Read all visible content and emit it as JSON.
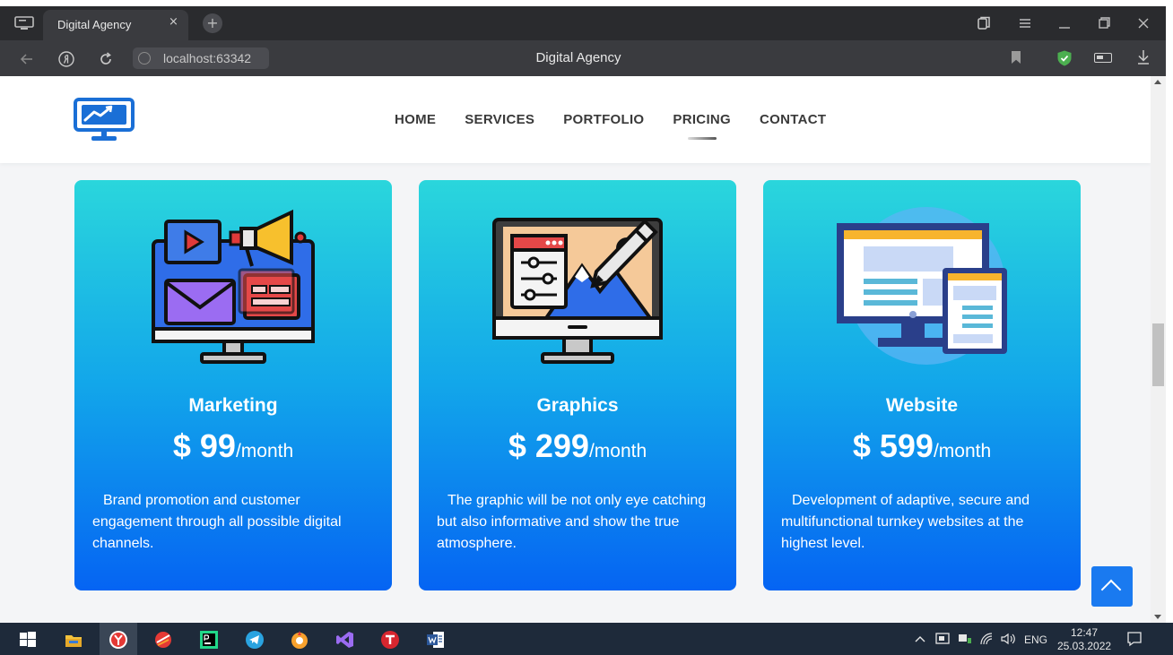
{
  "browser": {
    "tab_title": "Digital Agency",
    "tab_close": "×",
    "new_tab": "+",
    "url": "localhost:63342",
    "page_title": "Digital Agency"
  },
  "site": {
    "nav": [
      {
        "label": "HOME",
        "active": false
      },
      {
        "label": "SERVICES",
        "active": false
      },
      {
        "label": "PORTFOLIO",
        "active": false
      },
      {
        "label": "PRICING",
        "active": true
      },
      {
        "label": "CONTACT",
        "active": false
      }
    ],
    "cards": [
      {
        "name": "Marketing",
        "price": "$ 99",
        "period": "/month",
        "description": "Brand promotion and customer engagement through all possible digital channels."
      },
      {
        "name": "Graphics",
        "price": "$ 299",
        "period": "/month",
        "description": "The graphic will be not only eye catching but also informative and show the true atmosphere."
      },
      {
        "name": "Website",
        "price": "$ 599",
        "period": "/month",
        "description": "Development of adaptive, secure and multifunctional turnkey websites at the highest level."
      }
    ]
  },
  "taskbar": {
    "lang": "ENG",
    "time": "12:47",
    "date": "25.03.2022"
  },
  "colors": {
    "card_top": "#2ad6dc",
    "card_bottom": "#0564f3",
    "accent": "#1a7af0",
    "chrome_dark": "#2a2b2e"
  }
}
